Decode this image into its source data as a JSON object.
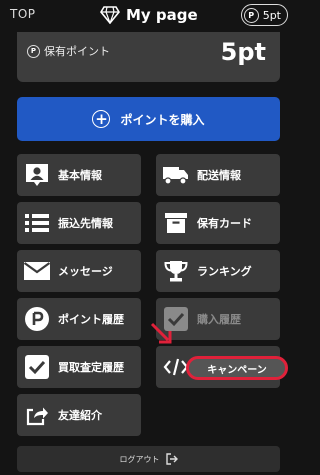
{
  "header": {
    "top_link": "TOP",
    "title": "My page",
    "points_badge": "5pt",
    "badge_symbol": "P"
  },
  "points_card": {
    "symbol": "P",
    "label": "保有ポイント",
    "value": "5pt"
  },
  "buy_button": {
    "label": "ポイントを購入"
  },
  "menu": {
    "basic_info": "基本情報",
    "shipping_info": "配送情報",
    "bank_info": "振込先情報",
    "owned_cards": "保有カード",
    "messages": "メッセージ",
    "ranking": "ランキング",
    "point_history": "ポイント履歴",
    "purchase_history": "購入履歴",
    "buyback_history": "買取査定履歴",
    "campaign": "キャンペーン",
    "referral": "友達紹介"
  },
  "logout": {
    "label": "ログアウト"
  },
  "colors": {
    "background": "#141414",
    "tile": "#3a3a3a",
    "primary_button": "#2159c4",
    "highlight": "#e0213a"
  }
}
